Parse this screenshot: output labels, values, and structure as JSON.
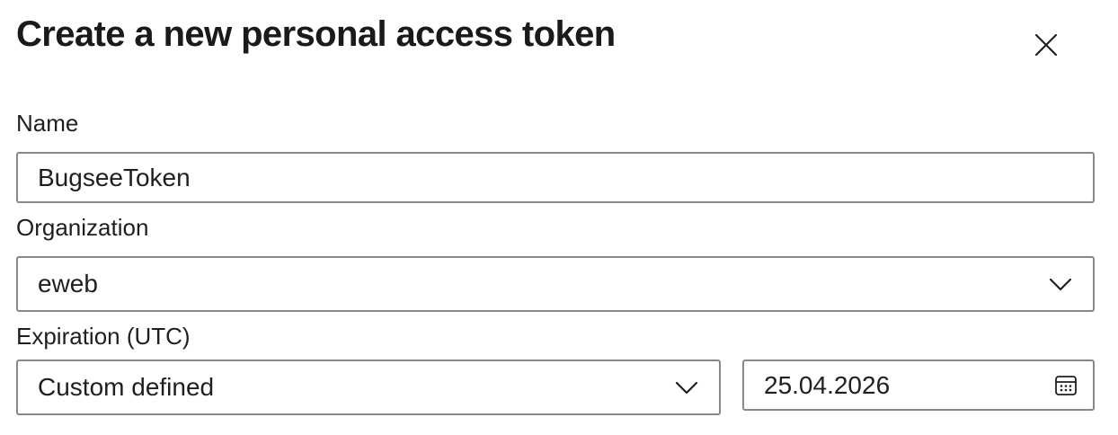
{
  "dialog": {
    "title": "Create a new personal access token",
    "close_icon": "close-icon"
  },
  "name_field": {
    "label": "Name",
    "value": "BugseeToken"
  },
  "organization_field": {
    "label": "Organization",
    "selected": "eweb",
    "icon": "chevron-down-icon"
  },
  "expiration_field": {
    "label": "Expiration (UTC)",
    "selected": "Custom defined",
    "date_value": "25.04.2026",
    "dropdown_icon": "chevron-down-icon",
    "calendar_icon": "calendar-icon"
  },
  "colors": {
    "border": "#8a8886",
    "text": "#201f1e",
    "background": "#ffffff"
  }
}
